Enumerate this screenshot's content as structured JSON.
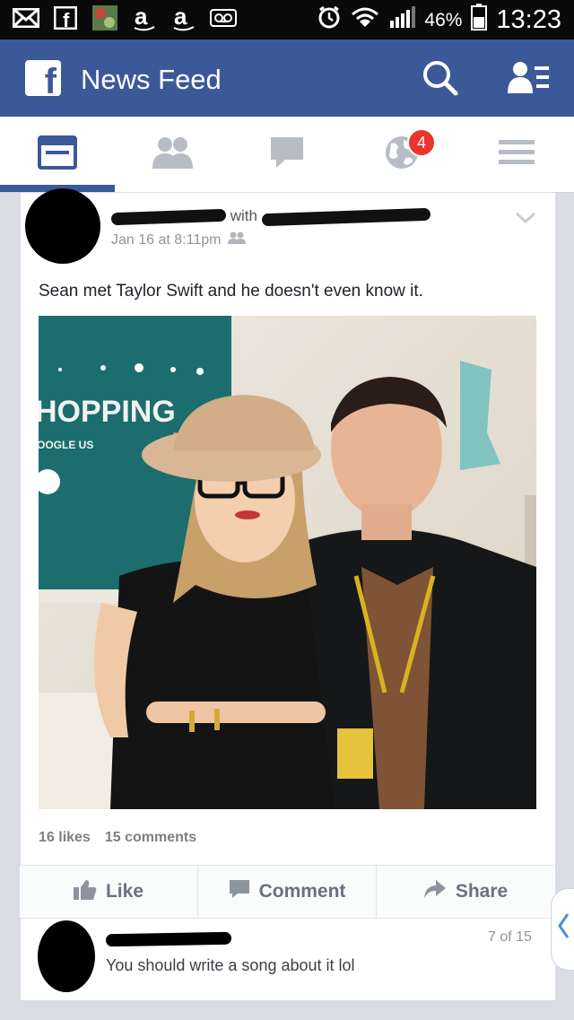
{
  "status_bar": {
    "battery": "46%",
    "time": "13:23",
    "icons": [
      "mail-icon",
      "facebook-icon",
      "wallpaper-icon",
      "amazon-icon",
      "amazon-icon",
      "voicemail-icon",
      "alarm-icon",
      "wifi-icon",
      "signal-icon",
      "battery-icon"
    ]
  },
  "header": {
    "logo": "f",
    "title": "News Feed"
  },
  "tabs": [
    {
      "icon": "news-feed-icon"
    },
    {
      "icon": "friends-icon"
    },
    {
      "icon": "messages-icon"
    },
    {
      "icon": "notifications-globe-icon",
      "badge": "4"
    },
    {
      "icon": "menu-icon"
    }
  ],
  "post": {
    "with": "with",
    "date": "Jan 16 at 8:11pm",
    "text": "Sean met Taylor Swift and he doesn't even know it.",
    "likes": "16 likes",
    "comments": "15 comments"
  },
  "actions": {
    "like": "Like",
    "comment": "Comment",
    "share": "Share"
  },
  "comment": {
    "text": "You should write a song about it lol",
    "pager": "7 of 15"
  },
  "photo": {
    "sign_line1": "HOPPING",
    "sign_line2": "OOGLE US"
  },
  "colors": {
    "brand": "#3b5998",
    "badge": "#e9352c"
  }
}
